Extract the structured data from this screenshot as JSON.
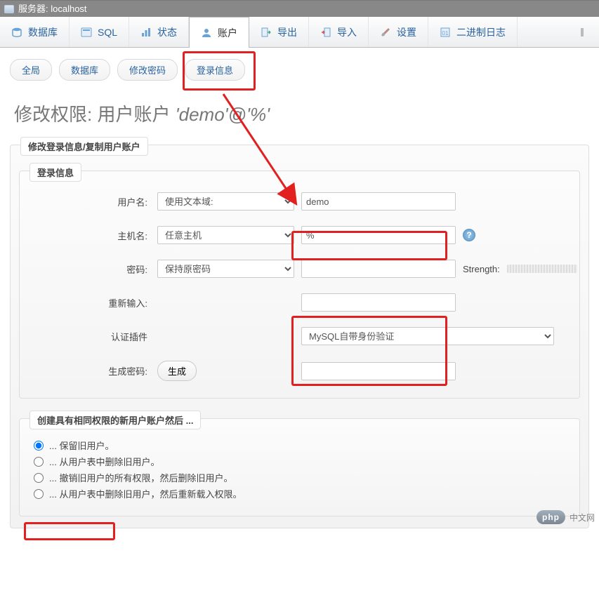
{
  "titlebar": {
    "text": "服务器: localhost"
  },
  "toptabs": [
    {
      "label": "数据库",
      "icon": "database"
    },
    {
      "label": "SQL",
      "icon": "sql"
    },
    {
      "label": "状态",
      "icon": "status"
    },
    {
      "label": "账户",
      "icon": "accounts",
      "active": true
    },
    {
      "label": "导出",
      "icon": "export"
    },
    {
      "label": "导入",
      "icon": "import"
    },
    {
      "label": "设置",
      "icon": "settings"
    },
    {
      "label": "二进制日志",
      "icon": "binlog"
    }
  ],
  "subtabs": [
    {
      "label": "全局"
    },
    {
      "label": "数据库"
    },
    {
      "label": "修改密码"
    },
    {
      "label": "登录信息",
      "highlighted": true
    }
  ],
  "page_title_prefix": "修改权限:   用户账户 ",
  "page_title_account": "'demo'@'%'",
  "group1_legend": "修改登录信息/复制用户账户",
  "login_legend": "登录信息",
  "fields": {
    "username": {
      "label": "用户名:",
      "select": "使用文本域:",
      "value": "demo"
    },
    "host": {
      "label": "主机名:",
      "select": "任意主机",
      "value": "%"
    },
    "password": {
      "label": "密码:",
      "select": "保持原密码",
      "value": "",
      "strength_label": "Strength:"
    },
    "retype": {
      "label": "重新输入:",
      "value": ""
    },
    "authplugin": {
      "label": "认证插件",
      "select": "MySQL自带身份验证"
    },
    "genpwd": {
      "label": "生成密码:",
      "button": "生成",
      "value": ""
    }
  },
  "group2_legend": "创建具有相同权限的新用户账户然后 ...",
  "radio_options": [
    "... 保留旧用户。",
    "... 从用户表中删除旧用户。",
    "... 撤销旧用户的所有权限，然后删除旧用户。",
    "... 从用户表中删除旧用户，然后重新载入权限。"
  ],
  "watermark": {
    "logo": "php",
    "text": "中文网"
  }
}
